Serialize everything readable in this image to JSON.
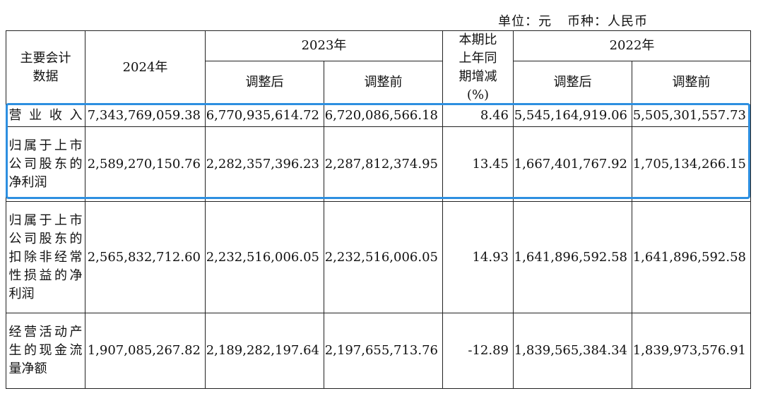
{
  "unit": {
    "unit_label": "单位：元",
    "currency_label": "币种：人民币"
  },
  "table": {
    "header": {
      "item_label": "主要会计数据",
      "y2024": "2024年",
      "y2023": "2023年",
      "change": "本期比上年同期增减(%)",
      "y2022": "2022年",
      "adjusted_after": "调整后",
      "adjusted_before": "调整前"
    },
    "rows": [
      {
        "label": "营业收入",
        "v2024": "7,343,769,059.38",
        "v2023_after": "6,770,935,614.72",
        "v2023_before": "6,720,086,566.18",
        "change": "8.46",
        "v2022_after": "5,545,164,919.06",
        "v2022_before": "5,505,301,557.73"
      },
      {
        "label": "归属于上市公司股东的净利润",
        "v2024": "2,589,270,150.76",
        "v2023_after": "2,282,357,396.23",
        "v2023_before": "2,287,812,374.95",
        "change": "13.45",
        "v2022_after": "1,667,401,767.92",
        "v2022_before": "1,705,134,266.15"
      },
      {
        "label": "归属于上市公司股东的扣除非经常性损益的净利润",
        "v2024": "2,565,832,712.60",
        "v2023_after": "2,232,516,006.05",
        "v2023_before": "2,232,516,006.05",
        "change": "14.93",
        "v2022_after": "1,641,896,592.58",
        "v2022_before": "1,641,896,592.58"
      },
      {
        "label": "经营活动产生的现金流量净额",
        "v2024": "1,907,085,267.82",
        "v2023_after": "2,189,282,197.64",
        "v2023_before": "2,197,655,713.76",
        "change": "-12.89",
        "v2022_after": "1,839,565,384.34",
        "v2022_before": "1,839,973,576.91"
      }
    ]
  },
  "highlight_color": "#2d8fe0"
}
